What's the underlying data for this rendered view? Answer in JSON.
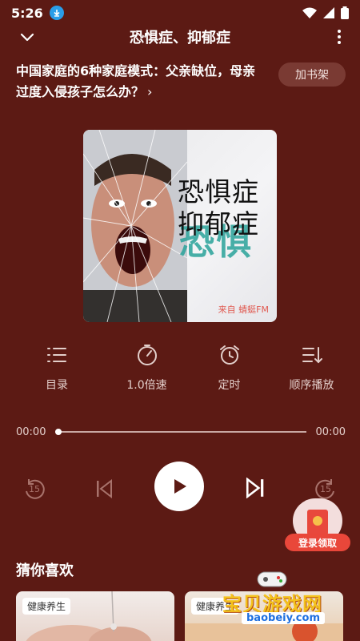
{
  "status_bar": {
    "time": "5:26"
  },
  "header": {
    "title": "恐惧症、抑郁症"
  },
  "episode": {
    "title": "中国家庭的6种家庭模式：父亲缺位，母亲过度入侵孩子怎么办？",
    "arrow": "›"
  },
  "actions": {
    "bookshelf_label": "加书架"
  },
  "cover": {
    "title_line1": "恐惧症",
    "title_line2": "抑郁症",
    "background_text": "恐惧",
    "source": "来自 蜻蜓FM"
  },
  "controls": [
    {
      "label": "目录",
      "icon": "list-icon"
    },
    {
      "label": "1.0倍速",
      "icon": "speed-icon"
    },
    {
      "label": "定时",
      "icon": "alarm-clock-icon"
    },
    {
      "label": "顺序播放",
      "icon": "sequence-icon"
    }
  ],
  "progress": {
    "current": "00:00",
    "total": "00:00",
    "fraction": 0.0
  },
  "player": {
    "rewind_seconds": "15",
    "forward_seconds": "15"
  },
  "promo": {
    "login_label": "登录领取"
  },
  "recommendations": {
    "title": "猜你喜欢",
    "items": [
      {
        "tag": "健康养生"
      },
      {
        "tag": "健康养生"
      }
    ]
  },
  "watermark": {
    "text": "宝贝游戏网",
    "url": "baobeiy.com"
  },
  "colors": {
    "background": "#5c1a14",
    "accent_red": "#e9473a",
    "button_bg": "#7a3a33"
  }
}
